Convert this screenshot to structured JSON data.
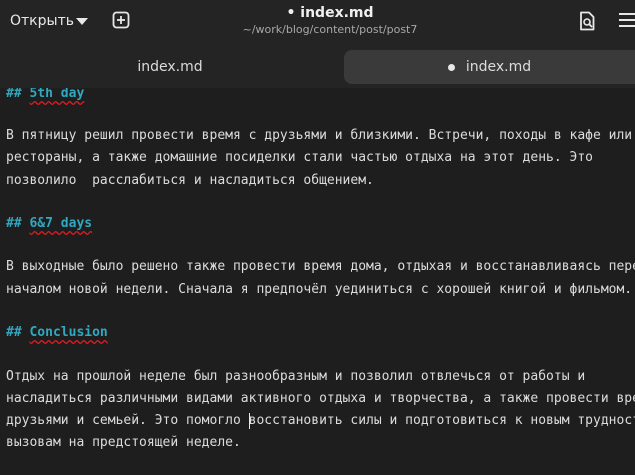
{
  "header": {
    "open_label": "Открыть",
    "title": "• index.md",
    "subtitle": "~/work/blog/content/post/post7"
  },
  "tabs": [
    {
      "label": "index.md",
      "active": false,
      "modified": false
    },
    {
      "label": "index.md",
      "active": true,
      "modified": true
    }
  ],
  "editor": {
    "h1_marker": "## ",
    "h1_text": "5th day",
    "p1": [
      "В пятницу решил провести время с друзьями и близкими. Встречи, походы в кафе или",
      "рестораны, а также домашние посиделки стали частью отдыха на этот день. Это",
      "позволило  расслабиться и насладиться общением."
    ],
    "h2_marker": "## ",
    "h2_text": "6&7 days",
    "p2": [
      "В выходные было решено также провести время дома, отдыхая и восстанавливаясь перед",
      "началом новой недели. Сначала я предпочёл уединиться с хорошей книгой и фильмом."
    ],
    "h3_marker": "## ",
    "h3_text": "Conclusion",
    "p3": [
      "Отдых на прошлой неделе был разнообразным и позволил отвлечься от работы и",
      "насладиться различными видами активного отдыха и творчества, а также провести время с",
      "друзьями и семьей. Это помогло ",
      "восстановить силы и подготовиться к новым трудностям и",
      "вызовам на предстоящей неделе."
    ]
  },
  "colors": {
    "background": "#1e1e1e",
    "headerbar": "#242424",
    "heading": "#32a8c0",
    "spellcheck": "#e01b24"
  }
}
